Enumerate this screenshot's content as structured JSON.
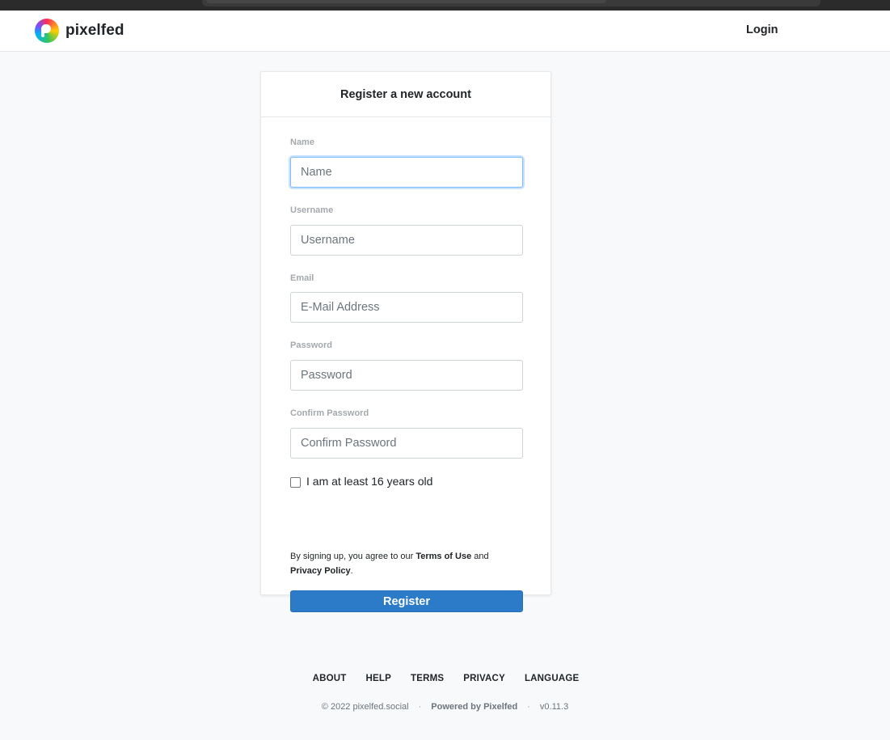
{
  "navbar": {
    "brand_name": "pixelfed",
    "login_label": "Login"
  },
  "card": {
    "title": "Register a new account",
    "fields": {
      "name": {
        "label": "Name",
        "placeholder": "Name",
        "value": ""
      },
      "username": {
        "label": "Username",
        "placeholder": "Username",
        "value": ""
      },
      "email": {
        "label": "Email",
        "placeholder": "E-Mail Address",
        "value": ""
      },
      "password": {
        "label": "Password",
        "placeholder": "Password",
        "value": ""
      },
      "confirm_password": {
        "label": "Confirm Password",
        "placeholder": "Confirm Password",
        "value": ""
      }
    },
    "age_checkbox": {
      "label": "I am at least 16 years old",
      "checked": false
    },
    "terms": {
      "prefix": "By signing up, you agree to our ",
      "terms_link": "Terms of Use",
      "middle": " and",
      "privacy_link": "Privacy Policy",
      "suffix": "."
    },
    "register_label": "Register"
  },
  "footer": {
    "links": [
      "ABOUT",
      "HELP",
      "TERMS",
      "PRIVACY",
      "LANGUAGE"
    ],
    "copyright": "© 2022 pixelfed.social",
    "separator": "·",
    "powered_by": "Powered by Pixelfed",
    "version": "v0.11.3"
  },
  "colors": {
    "accent": "#2b7bc9",
    "background": "#f8f9fa",
    "focus_border": "#80bdff"
  },
  "icons": {
    "logo": "pixelfed-logo-icon"
  }
}
